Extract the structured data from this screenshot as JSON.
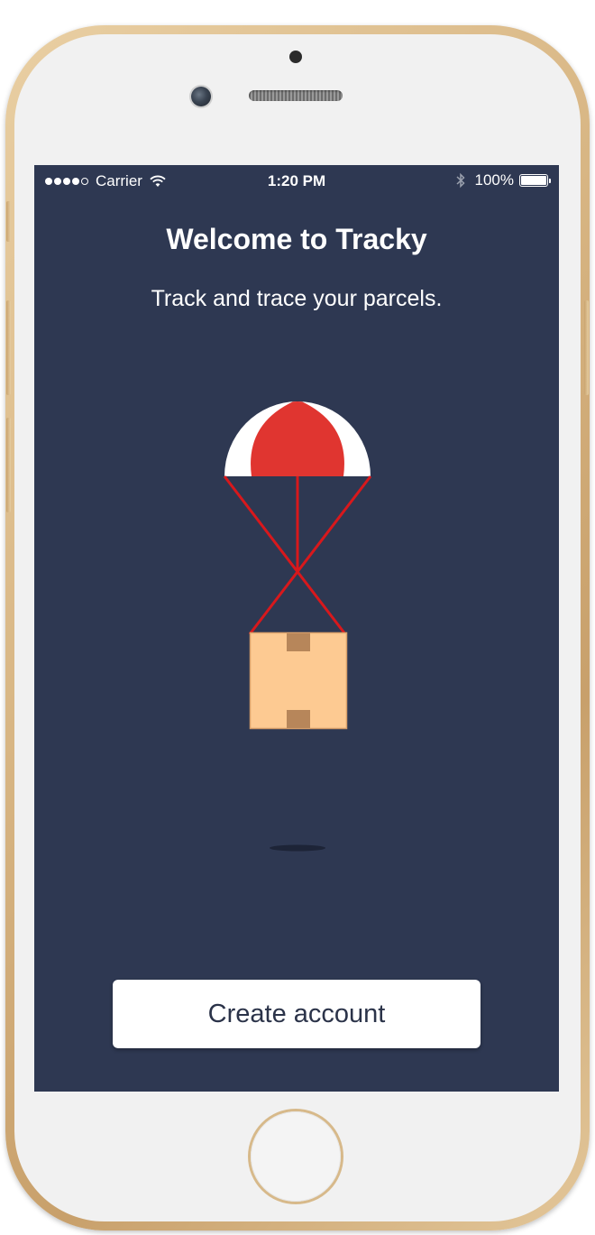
{
  "status_bar": {
    "carrier": "Carrier",
    "time": "1:20 PM",
    "battery_percent": "100%",
    "signal_bars_filled": 4,
    "signal_bars_total": 5
  },
  "welcome": {
    "title": "Welcome to Tracky",
    "subtitle": "Track and trace your parcels."
  },
  "illustration": {
    "icons": [
      "parachute-icon",
      "parcel-box-icon",
      "shadow"
    ],
    "colors": {
      "background": "#2e3852",
      "canopy_red": "#e03530",
      "canopy_white": "#ffffff",
      "lines": "#d8181c",
      "box": "#fdca92",
      "box_tape": "#b7865a"
    }
  },
  "actions": {
    "create_account_label": "Create account"
  },
  "device": {
    "frame_color": "#d8b684",
    "face_color": "#f1f1f1"
  }
}
